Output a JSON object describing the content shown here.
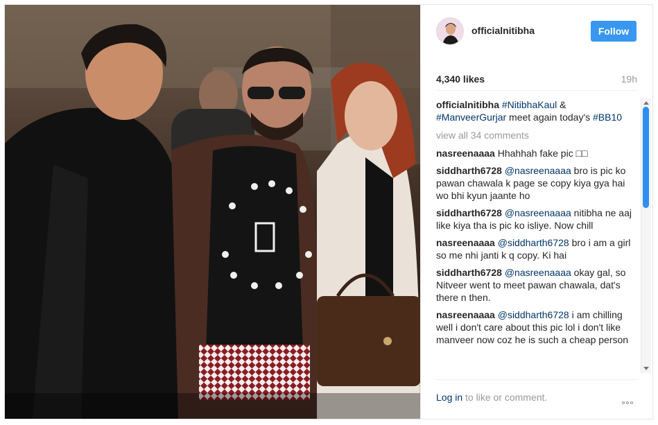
{
  "post": {
    "username": "officialnitibha",
    "follow_label": "Follow",
    "likes": "4,340 likes",
    "time": "19h"
  },
  "caption": {
    "user": "officialnitibha",
    "tag1": "#NitibhaKaul",
    "amp": " & ",
    "tag2": "#ManveerGurjar",
    "text": " meet again today's ",
    "tag3": "#BB10"
  },
  "view_all_comments": "view all 34 comments",
  "comments": [
    {
      "user": "nasreenaaaa",
      "mention": "",
      "text": " Hhahhah fake pic □□"
    },
    {
      "user": "siddharth6728",
      "mention": " @nasreenaaaa",
      "text": " bro is pic ko pawan chawala k page se copy kiya gya hai wo bhi kyun jaante ho"
    },
    {
      "user": "siddharth6728",
      "mention": " @nasreenaaaa",
      "text": " nitibha ne aaj like kiya tha is pic ko isliye. Now chill"
    },
    {
      "user": "nasreenaaaa",
      "mention": " @siddharth6728",
      "text": " bro i am a girl so me nhi janti k q copy. Ki hai"
    },
    {
      "user": "siddharth6728",
      "mention": " @nasreenaaaa",
      "text": " okay gal, so Nitveer went to meet pawan chawala, dat's there n then."
    },
    {
      "user": "nasreenaaaa",
      "mention": " @siddharth6728",
      "text": " i am chilling well i don't care about this pic lol i don't like manveer now coz he is such a cheap person"
    }
  ],
  "footer": {
    "login_label": "Log in",
    "rest": " to like or comment."
  },
  "icons": {
    "more": "more-options-icon"
  },
  "colors": {
    "follow_bg": "#3897f0",
    "link": "#003569",
    "muted": "#999999"
  }
}
